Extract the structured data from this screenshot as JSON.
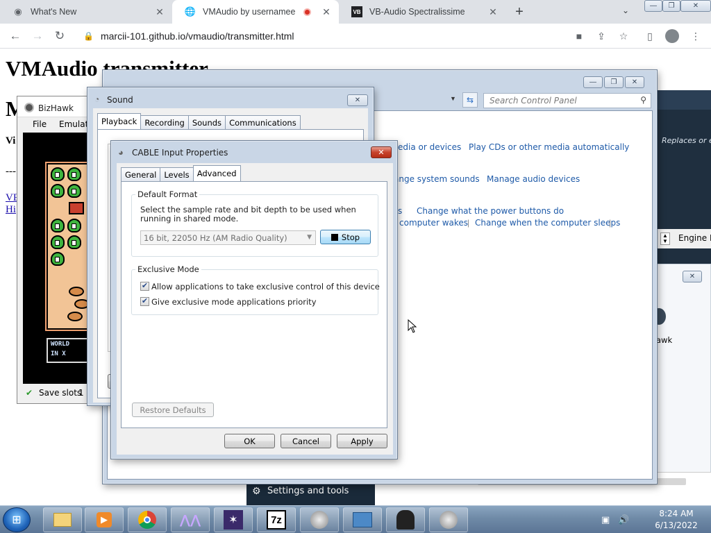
{
  "browser": {
    "tabs": [
      {
        "title": "What's New",
        "close": "✕"
      },
      {
        "title": "VMAudio by usernamee",
        "close": "✕"
      },
      {
        "title": "VB-Audio Spectralissime",
        "close": "✕"
      }
    ],
    "new_tab": "+",
    "favicon_vb": "VB",
    "url": "marcii-101.github.io/vmaudio/transmitter.html",
    "page_heading": "VMAudio transmitter",
    "page_fragments": {
      "m": "M",
      "vi": "Vi",
      "dashes": "---",
      "link1": "VE",
      "link2": "Hi"
    },
    "window_controls": {
      "min": "—",
      "max": "❐",
      "close": "✕"
    }
  },
  "control_panel": {
    "search_placeholder": "Search Control Panel",
    "links": {
      "media_devices": "edia or devices",
      "play_cds": "Play CDs or other media automatically",
      "system_sounds": "ange system sounds",
      "manage_audio": "Manage audio devices",
      "s": "s",
      "power_buttons": "Change what the power buttons do",
      "computer_wakes": "computer wakes",
      "computer_sleeps": "Change when the computer sleeps"
    },
    "sep": "|"
  },
  "dark_app": {
    "replaces": "Replaces or edi",
    "engine": "Engine P",
    "hawk": "awk",
    "settings": "Settings and tools"
  },
  "bizhawk": {
    "title": "BizHawk",
    "menu_file": "File",
    "menu_emulation": "Emulati",
    "save_slots": "Save slots",
    "save_slot_num": "1",
    "world_label": "WORLD",
    "world_sub": "IN X"
  },
  "sound": {
    "title": "Sound",
    "tabs": [
      "Playback",
      "Recording",
      "Sounds",
      "Communications"
    ]
  },
  "cable": {
    "title": "CABLE Input Properties",
    "tabs": [
      "General",
      "Levels",
      "Advanced"
    ],
    "default_format": {
      "label": "Default Format",
      "description": "Select the sample rate and bit depth to be used when running in shared mode.",
      "selected": "16 bit, 22050 Hz (AM Radio Quality)",
      "stop_button": "Stop"
    },
    "exclusive": {
      "label": "Exclusive Mode",
      "allow_exclusive": "Allow applications to take exclusive control of this device",
      "give_priority": "Give exclusive mode applications priority"
    },
    "restore_defaults": "Restore Defaults",
    "ok": "OK",
    "cancel": "Cancel",
    "apply": "Apply"
  },
  "taskbar": {
    "start": "⊞",
    "items": [
      "explorer",
      "media-player",
      "chrome",
      "vb-audio",
      "mascot-app",
      "7z",
      "speaker",
      "control-panel",
      "vmaudio",
      "speaker"
    ],
    "seven_zip": "7z",
    "time": "8:24 AM",
    "date": "6/13/2022"
  }
}
